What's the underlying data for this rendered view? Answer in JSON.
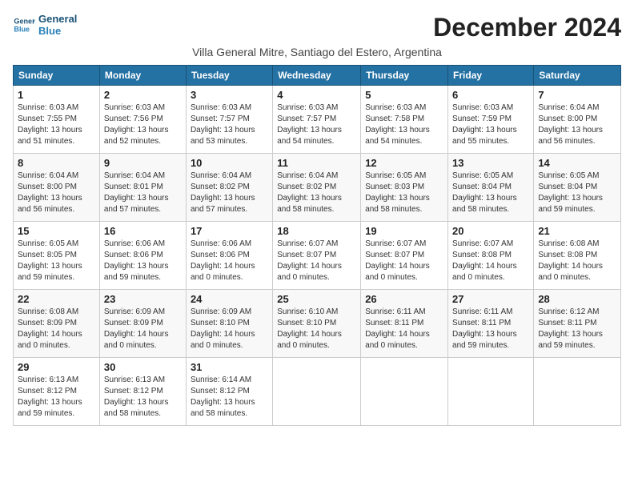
{
  "logo": {
    "line1": "General",
    "line2": "Blue"
  },
  "title": "December 2024",
  "subtitle": "Villa General Mitre, Santiago del Estero, Argentina",
  "days_of_week": [
    "Sunday",
    "Monday",
    "Tuesday",
    "Wednesday",
    "Thursday",
    "Friday",
    "Saturday"
  ],
  "weeks": [
    [
      {
        "day": "1",
        "sunrise": "6:03 AM",
        "sunset": "7:55 PM",
        "daylight": "13 hours and 51 minutes."
      },
      {
        "day": "2",
        "sunrise": "6:03 AM",
        "sunset": "7:56 PM",
        "daylight": "13 hours and 52 minutes."
      },
      {
        "day": "3",
        "sunrise": "6:03 AM",
        "sunset": "7:57 PM",
        "daylight": "13 hours and 53 minutes."
      },
      {
        "day": "4",
        "sunrise": "6:03 AM",
        "sunset": "7:57 PM",
        "daylight": "13 hours and 54 minutes."
      },
      {
        "day": "5",
        "sunrise": "6:03 AM",
        "sunset": "7:58 PM",
        "daylight": "13 hours and 54 minutes."
      },
      {
        "day": "6",
        "sunrise": "6:03 AM",
        "sunset": "7:59 PM",
        "daylight": "13 hours and 55 minutes."
      },
      {
        "day": "7",
        "sunrise": "6:04 AM",
        "sunset": "8:00 PM",
        "daylight": "13 hours and 56 minutes."
      }
    ],
    [
      {
        "day": "8",
        "sunrise": "6:04 AM",
        "sunset": "8:00 PM",
        "daylight": "13 hours and 56 minutes."
      },
      {
        "day": "9",
        "sunrise": "6:04 AM",
        "sunset": "8:01 PM",
        "daylight": "13 hours and 57 minutes."
      },
      {
        "day": "10",
        "sunrise": "6:04 AM",
        "sunset": "8:02 PM",
        "daylight": "13 hours and 57 minutes."
      },
      {
        "day": "11",
        "sunrise": "6:04 AM",
        "sunset": "8:02 PM",
        "daylight": "13 hours and 58 minutes."
      },
      {
        "day": "12",
        "sunrise": "6:05 AM",
        "sunset": "8:03 PM",
        "daylight": "13 hours and 58 minutes."
      },
      {
        "day": "13",
        "sunrise": "6:05 AM",
        "sunset": "8:04 PM",
        "daylight": "13 hours and 58 minutes."
      },
      {
        "day": "14",
        "sunrise": "6:05 AM",
        "sunset": "8:04 PM",
        "daylight": "13 hours and 59 minutes."
      }
    ],
    [
      {
        "day": "15",
        "sunrise": "6:05 AM",
        "sunset": "8:05 PM",
        "daylight": "13 hours and 59 minutes."
      },
      {
        "day": "16",
        "sunrise": "6:06 AM",
        "sunset": "8:06 PM",
        "daylight": "13 hours and 59 minutes."
      },
      {
        "day": "17",
        "sunrise": "6:06 AM",
        "sunset": "8:06 PM",
        "daylight": "14 hours and 0 minutes."
      },
      {
        "day": "18",
        "sunrise": "6:07 AM",
        "sunset": "8:07 PM",
        "daylight": "14 hours and 0 minutes."
      },
      {
        "day": "19",
        "sunrise": "6:07 AM",
        "sunset": "8:07 PM",
        "daylight": "14 hours and 0 minutes."
      },
      {
        "day": "20",
        "sunrise": "6:07 AM",
        "sunset": "8:08 PM",
        "daylight": "14 hours and 0 minutes."
      },
      {
        "day": "21",
        "sunrise": "6:08 AM",
        "sunset": "8:08 PM",
        "daylight": "14 hours and 0 minutes."
      }
    ],
    [
      {
        "day": "22",
        "sunrise": "6:08 AM",
        "sunset": "8:09 PM",
        "daylight": "14 hours and 0 minutes."
      },
      {
        "day": "23",
        "sunrise": "6:09 AM",
        "sunset": "8:09 PM",
        "daylight": "14 hours and 0 minutes."
      },
      {
        "day": "24",
        "sunrise": "6:09 AM",
        "sunset": "8:10 PM",
        "daylight": "14 hours and 0 minutes."
      },
      {
        "day": "25",
        "sunrise": "6:10 AM",
        "sunset": "8:10 PM",
        "daylight": "14 hours and 0 minutes."
      },
      {
        "day": "26",
        "sunrise": "6:11 AM",
        "sunset": "8:11 PM",
        "daylight": "14 hours and 0 minutes."
      },
      {
        "day": "27",
        "sunrise": "6:11 AM",
        "sunset": "8:11 PM",
        "daylight": "13 hours and 59 minutes."
      },
      {
        "day": "28",
        "sunrise": "6:12 AM",
        "sunset": "8:11 PM",
        "daylight": "13 hours and 59 minutes."
      }
    ],
    [
      {
        "day": "29",
        "sunrise": "6:13 AM",
        "sunset": "8:12 PM",
        "daylight": "13 hours and 59 minutes."
      },
      {
        "day": "30",
        "sunrise": "6:13 AM",
        "sunset": "8:12 PM",
        "daylight": "13 hours and 58 minutes."
      },
      {
        "day": "31",
        "sunrise": "6:14 AM",
        "sunset": "8:12 PM",
        "daylight": "13 hours and 58 minutes."
      },
      null,
      null,
      null,
      null
    ]
  ],
  "labels": {
    "sunrise": "Sunrise:",
    "sunset": "Sunset:",
    "daylight": "Daylight:"
  }
}
